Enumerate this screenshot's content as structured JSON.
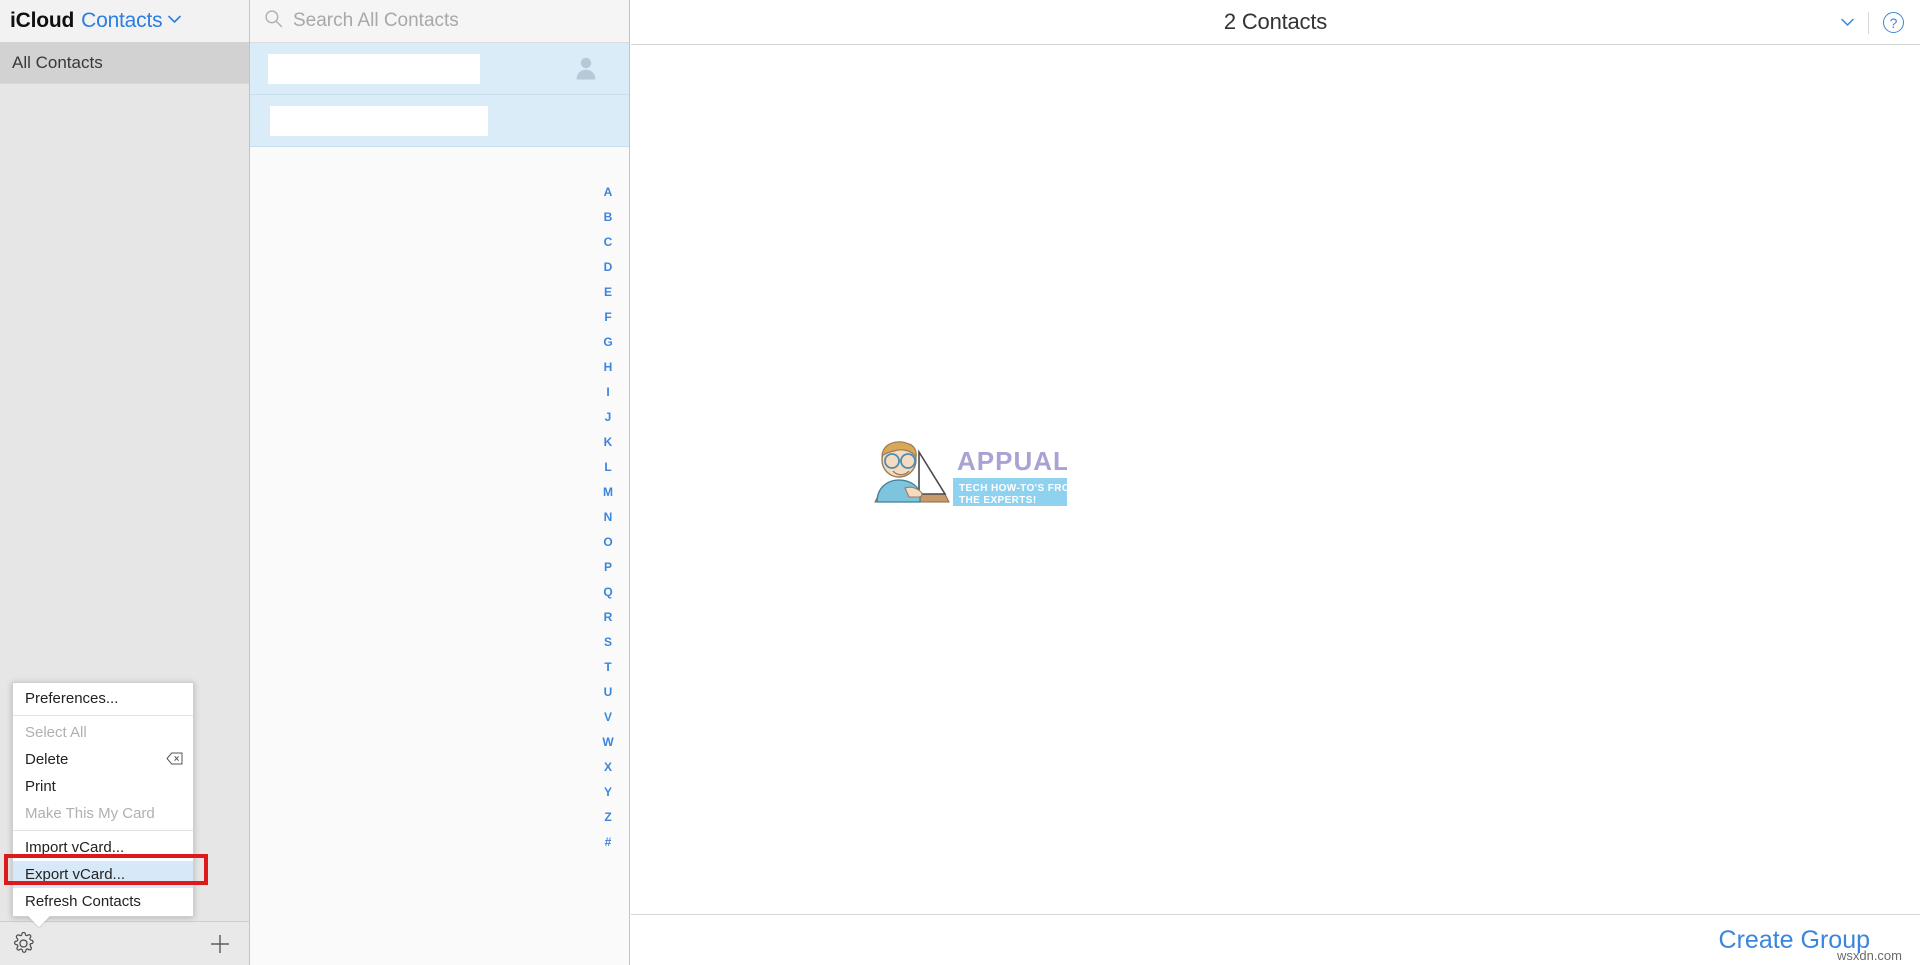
{
  "sidebar": {
    "brand": "iCloud",
    "app_name": "Contacts",
    "app_chevron_icon": "chevron-down-icon",
    "items": [
      {
        "label": "All Contacts",
        "selected": true
      }
    ],
    "footer": {
      "gear_icon": "gear-icon",
      "plus_icon": "plus-icon"
    }
  },
  "context_menu": {
    "items": [
      {
        "label": "Preferences...",
        "disabled": false,
        "shortcut": "",
        "highlighted": false,
        "separator_after": true
      },
      {
        "label": "Select All",
        "disabled": true,
        "shortcut": "",
        "highlighted": false,
        "separator_after": false
      },
      {
        "label": "Delete",
        "disabled": false,
        "shortcut": "delete-key-icon",
        "highlighted": false,
        "separator_after": false
      },
      {
        "label": "Print",
        "disabled": false,
        "shortcut": "",
        "highlighted": false,
        "separator_after": false
      },
      {
        "label": "Make This My Card",
        "disabled": true,
        "shortcut": "",
        "highlighted": false,
        "separator_after": true
      },
      {
        "label": "Import vCard...",
        "disabled": false,
        "shortcut": "",
        "highlighted": false,
        "separator_after": false
      },
      {
        "label": "Export vCard...",
        "disabled": false,
        "shortcut": "",
        "highlighted": true,
        "separator_after": false
      },
      {
        "label": "Refresh Contacts",
        "disabled": false,
        "shortcut": "",
        "highlighted": false,
        "separator_after": false
      }
    ],
    "highlight_color": "#dd1a1a",
    "selected_item_bg": "#d7e9f8"
  },
  "search": {
    "icon": "search-icon",
    "placeholder": "Search All Contacts",
    "value": ""
  },
  "contact_list": {
    "rows": [
      {
        "name": "",
        "redacted": true,
        "has_avatar": true,
        "avatar_icon": "person-silhouette-icon"
      },
      {
        "name": "",
        "redacted": true,
        "has_avatar": false,
        "avatar_icon": ""
      }
    ],
    "selection_color": "#d9ecf8",
    "alphabet_index": [
      "A",
      "B",
      "C",
      "D",
      "E",
      "F",
      "G",
      "H",
      "I",
      "J",
      "K",
      "L",
      "M",
      "N",
      "O",
      "P",
      "Q",
      "R",
      "S",
      "T",
      "U",
      "V",
      "W",
      "X",
      "Y",
      "Z",
      "#"
    ],
    "index_color": "#3a86dd"
  },
  "main": {
    "title": "2 Contacts",
    "chevron_icon": "chevron-down-icon",
    "help_icon": "question-mark-icon",
    "help_label": "?",
    "create_group_label": "Create Group",
    "watermark": {
      "brand": "APPUALS",
      "tagline_line1": "TECH HOW-TO'S FROM",
      "tagline_line2": "THE EXPERTS!",
      "brand_color": "#a9a3d4",
      "band_color": "#8fd2ef"
    },
    "site_watermark": "wsxdn.com"
  }
}
